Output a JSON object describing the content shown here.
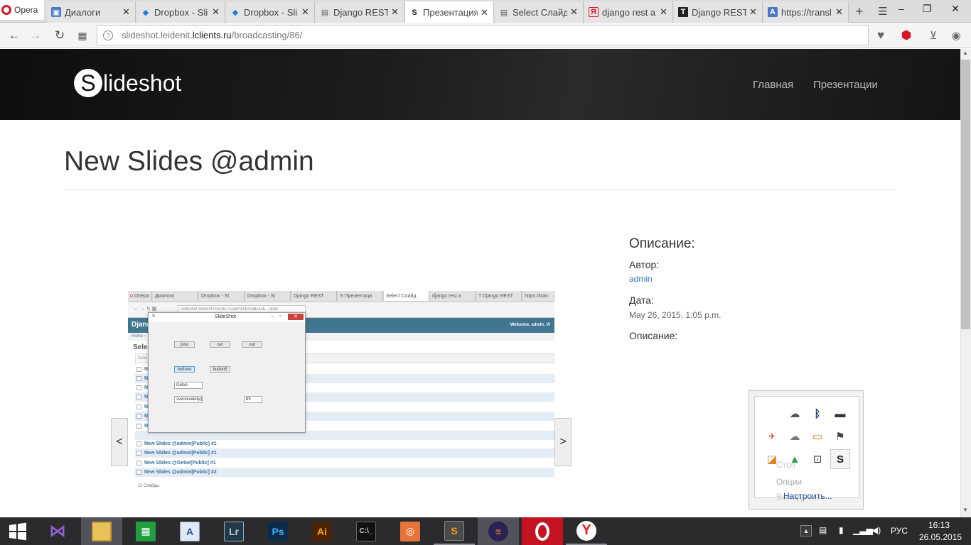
{
  "browser": {
    "opera_label": "Opera",
    "tabs": [
      {
        "label": "Диалоги",
        "icon": "dialog-icon"
      },
      {
        "label": "Dropbox - Sli",
        "icon": "dropbox-icon"
      },
      {
        "label": "Dropbox - Sli",
        "icon": "dropbox-icon"
      },
      {
        "label": "Django REST",
        "icon": "document-icon"
      },
      {
        "label": "Презентация",
        "icon": "slideshot-icon"
      },
      {
        "label": "Select Слайд",
        "icon": "document-icon"
      },
      {
        "label": "django rest a",
        "icon": "yandex-icon"
      },
      {
        "label": "Django REST",
        "icon": "t-icon"
      },
      {
        "label": "https://transl",
        "icon": "translate-icon"
      }
    ],
    "active_tab": 4,
    "url_host_pre": "slideshot.leidenit.",
    "url_host": "lclients.ru",
    "url_path": "/broadcasting/86/"
  },
  "site": {
    "logo_letter": "S",
    "logo_rest": "lideshot",
    "nav": [
      "Главная",
      "Презентации"
    ]
  },
  "page": {
    "title": "New Slides @admin",
    "prev_label": "<",
    "next_label": ">"
  },
  "description": {
    "heading": "Описание:",
    "author_label": "Автор:",
    "author_value": "admin",
    "date_label": "Дата:",
    "date_value": "May 26, 2015, 1:05 p.m.",
    "desc_label": "Описание:"
  },
  "slide": {
    "tabs": [
      "Опера",
      "Диалоги",
      "Dropbox - Sl",
      "Dropbox - Sl",
      "Django REST",
      "S Презентаци",
      "Select Слайд",
      "django rest a",
      "T Django REST",
      "https://tran"
    ],
    "url": "slideshot.leidenit.lclients.ru/admin/broadcasti...slide/",
    "header_left": "Djang",
    "header_right": "Welcome, admin. Vi",
    "breadcrumb": "Home ›",
    "select_label": "Sele",
    "action_label": "Actio",
    "rows": [
      "New Slides @admin[Public] #1",
      "New Slides @admin[Public] #1",
      "New Slides @Getxe[Public] #1",
      "New Slides @admin[Public] #2"
    ],
    "hidden_rows": [
      "N",
      "N",
      "N",
      "N",
      "N",
      "N",
      "N"
    ],
    "count_label": "11 Слайды",
    "dialog_title": "SlideShot",
    "dialog_buttons": [
      "post",
      "cet",
      "out",
      "button4",
      "button5"
    ],
    "dialog_input": "Getxe",
    "dialog_combo": "zverevvalety@",
    "dialog_spin": "85"
  },
  "tray": {
    "icons": [
      "cloud-sync-icon",
      "bluetooth-icon",
      "display-icon",
      "network-icon",
      "cloud-icon",
      "monitor-icon",
      "flag-icon",
      "sublime-icon",
      "google-drive-icon",
      "lock-icon",
      "slideshot-tray-icon"
    ],
    "menu_ghost_1": "Стоп",
    "menu_ghost_2": "Опции",
    "menu_ghost_3": "Выход",
    "customize": "Настроить..."
  },
  "taskbar": {
    "apps": [
      "windows-start-icon",
      "visual-studio-icon",
      "file-explorer-icon",
      "excel-icon",
      "word-icon",
      "lightroom-icon",
      "photoshop-icon",
      "illustrator-icon",
      "cmd-icon",
      "screenshot-icon",
      "sublime-text-icon",
      "eclipse-icon",
      "opera-icon",
      "yandex-browser-icon"
    ],
    "lr": "Lr",
    "ps": "Ps",
    "ai": "Ai",
    "lang": "РУС",
    "time": "16:13",
    "date": "26.05.2015"
  },
  "colors": {
    "header_dark": "#151515",
    "link": "#337ab7",
    "opera_red": "#d8152a",
    "taskbar": "#2b2b2e"
  }
}
